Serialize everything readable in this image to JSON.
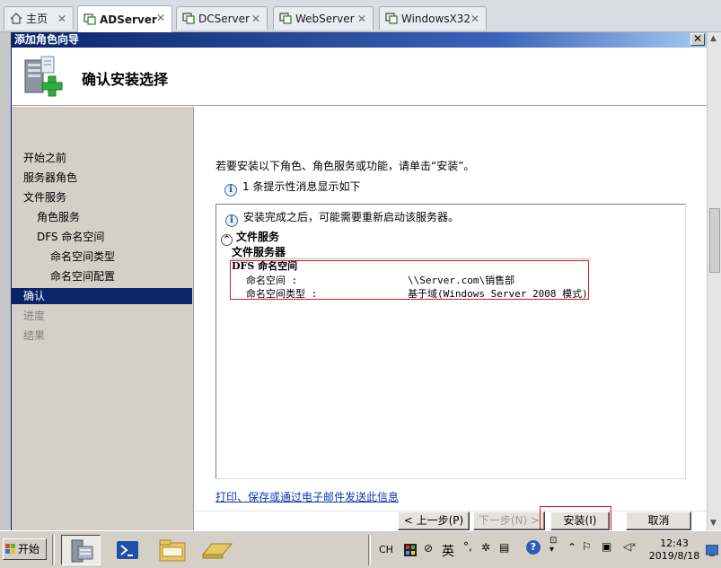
{
  "vm_tabs": [
    {
      "label": "主页",
      "icon": "home-icon",
      "active": false
    },
    {
      "label": "ADServer",
      "icon": "vm-icon",
      "active": true
    },
    {
      "label": "DCServer",
      "icon": "vm-icon",
      "active": false
    },
    {
      "label": "WebServer",
      "icon": "vm-icon",
      "active": false
    },
    {
      "label": "WindowsX32",
      "icon": "vm-icon",
      "active": false
    }
  ],
  "wizard": {
    "title": "添加角色向导",
    "close_glyph": "✕",
    "header_title": "确认安装选择",
    "nav_items": [
      {
        "label": "开始之前",
        "indent": 0,
        "state": "normal"
      },
      {
        "label": "服务器角色",
        "indent": 0,
        "state": "normal"
      },
      {
        "label": "文件服务",
        "indent": 0,
        "state": "normal"
      },
      {
        "label": "角色服务",
        "indent": 1,
        "state": "normal"
      },
      {
        "label": "DFS 命名空间",
        "indent": 1,
        "state": "normal"
      },
      {
        "label": "命名空间类型",
        "indent": 2,
        "state": "normal"
      },
      {
        "label": "命名空间配置",
        "indent": 2,
        "state": "normal"
      },
      {
        "label": "确认",
        "indent": 0,
        "state": "selected"
      },
      {
        "label": "进度",
        "indent": 0,
        "state": "disabled"
      },
      {
        "label": "结果",
        "indent": 0,
        "state": "disabled"
      }
    ],
    "intro_text": "若要安装以下角色、角色服务或功能，请单击“安装”。",
    "info_line": "1 条提示性消息显示如下",
    "details": {
      "warning": "安装完成之后，可能需要重新启动该服务器。",
      "section_title": "文件服务",
      "role_header": "文件服务器",
      "service": "DFS 命名空间",
      "rows": [
        {
          "key": "命名空间 :",
          "value": "\\\\Server.com\\销售部"
        },
        {
          "key": "命名空间类型 :",
          "value": "基于域(Windows Server 2008 模式)"
        }
      ]
    },
    "email_link": "打印、保存或通过电子邮件发送此信息",
    "buttons": {
      "prev": "< 上一步(P)",
      "next": "下一步(N) >",
      "install": "安装(I)",
      "cancel": "取消"
    }
  },
  "taskbar": {
    "start_label": "开始",
    "apps": [
      "server-manager-icon",
      "powershell-icon",
      "explorer-icon",
      "folder-icon"
    ],
    "tray": {
      "lang": "CH",
      "ime_text": "英",
      "time": "12:43",
      "date": "2019/8/18"
    }
  },
  "colors": {
    "titlebar": "#0a246a",
    "selection": "#0a246a",
    "highlight_box": "#d02020",
    "link": "#0b35b6"
  }
}
